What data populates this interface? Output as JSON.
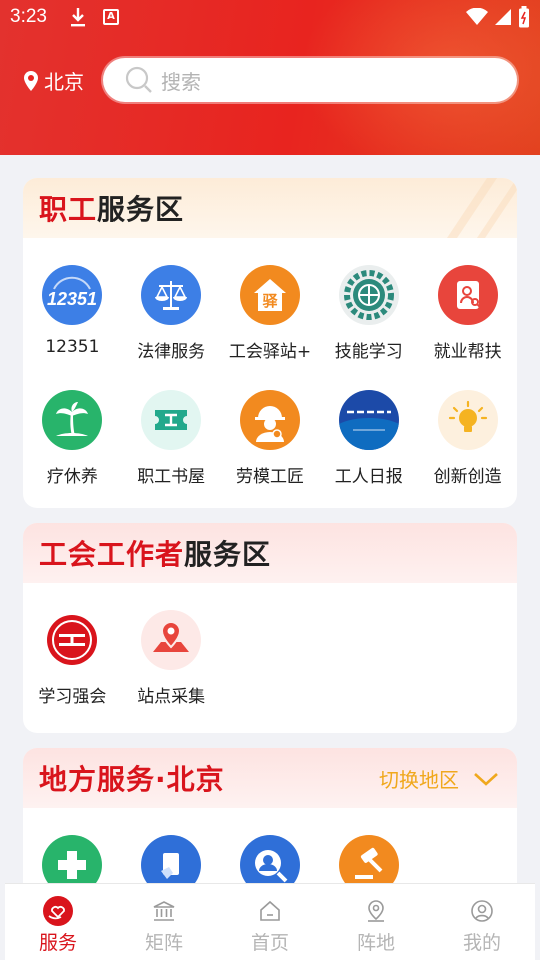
{
  "status": {
    "time": "3:23"
  },
  "header": {
    "city": "北京",
    "search_placeholder": "搜索"
  },
  "sections": [
    {
      "title_highlight": "职工",
      "title_tail": "服务区",
      "items": [
        {
          "label": "12351",
          "icon": "hotline-12351-icon",
          "color": "#3d7fe6"
        },
        {
          "label": "法律服务",
          "icon": "scales-icon",
          "color": "#3d7fe6"
        },
        {
          "label": "工会驿站+",
          "icon": "station-house-icon",
          "color": "#f28a1f"
        },
        {
          "label": "技能学习",
          "icon": "gear-globe-icon",
          "color": "#2c8a7c"
        },
        {
          "label": "就业帮扶",
          "icon": "job-profile-icon",
          "color": "#e8453c"
        },
        {
          "label": "疗休养",
          "icon": "palm-tree-icon",
          "color": "#28b46b"
        },
        {
          "label": "职工书屋",
          "icon": "bookstore-icon",
          "color": "#22a98c"
        },
        {
          "label": "劳模工匠",
          "icon": "worker-helmet-icon",
          "color": "#f28a1f"
        },
        {
          "label": "工人日报",
          "icon": "workers-daily-icon",
          "color": "#1c4aa8"
        },
        {
          "label": "创新创造",
          "icon": "lightbulb-icon",
          "color": "#f5b321"
        }
      ]
    },
    {
      "title_highlight": "工会工作者",
      "title_tail": "服务区",
      "items": [
        {
          "label": "学习强会",
          "icon": "union-emblem-icon",
          "color": "#d9141c"
        },
        {
          "label": "站点采集",
          "icon": "map-pin-icon",
          "color": "#e8453c"
        }
      ]
    },
    {
      "title_highlight": "地方服务·北京",
      "switch_label": "切换地区",
      "items": [
        {
          "icon": "medical-cross-icon",
          "color": "#28b46b"
        },
        {
          "icon": "document-hand-icon",
          "color": "#2f6fd8"
        },
        {
          "icon": "person-search-icon",
          "color": "#2f6fd8"
        },
        {
          "icon": "gavel-icon",
          "color": "#f28a1f"
        }
      ]
    }
  ],
  "tabs": [
    {
      "label": "服务",
      "icon": "service-heart-icon",
      "active": true
    },
    {
      "label": "矩阵",
      "icon": "bank-building-icon",
      "active": false
    },
    {
      "label": "首页",
      "icon": "home-icon",
      "active": false
    },
    {
      "label": "阵地",
      "icon": "location-pin-icon",
      "active": false
    },
    {
      "label": "我的",
      "icon": "user-profile-icon",
      "active": false
    }
  ]
}
